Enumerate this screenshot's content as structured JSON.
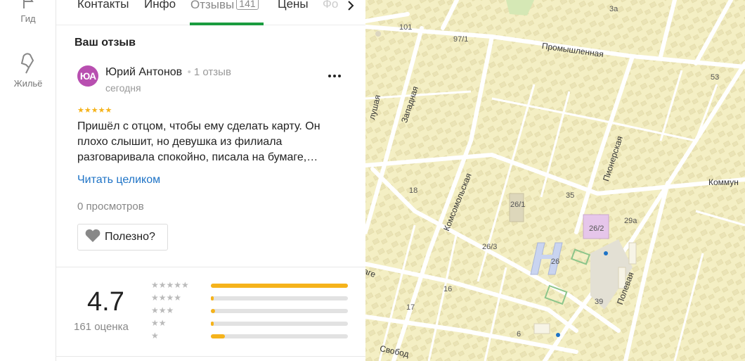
{
  "rail": {
    "guide_label": "Гид",
    "housing_label": "Жильё"
  },
  "tabs": {
    "contacts": "Контакты",
    "info": "Инфо",
    "reviews": "Отзывы",
    "reviews_count": "141",
    "prices": "Цены",
    "photos": "Фо"
  },
  "review": {
    "section_title": "Ваш отзыв",
    "avatar_initials": "ЮА",
    "avatar_color": "#b84fb0",
    "author": "Юрий Антонов",
    "author_reviews": "1 отзыв",
    "date": "сегодня",
    "rating": 5,
    "stars": "★★★★★",
    "text": "Пришёл с отцом, чтобы ему сделать карту. Он плохо слышит, но девушка из филиала разговаривала спокойно, писала на бумаге,…",
    "read_more": "Читать целиком",
    "views": "0 просмотров",
    "useful_label": "Полезно?"
  },
  "summary": {
    "rating": "4.7",
    "count_label": "161 оценка",
    "distribution": [
      {
        "stars": "★★★★★",
        "fraction": 1.0
      },
      {
        "stars": "★★★★",
        "fraction": 0.02
      },
      {
        "stars": "★★★",
        "fraction": 0.03
      },
      {
        "stars": "★★",
        "fraction": 0.02
      },
      {
        "stars": "★",
        "fraction": 0.1
      }
    ]
  },
  "map": {
    "streets": {
      "promyshlennaya": "Промышленная",
      "zapadnaya": "Западная",
      "pionerskaya": "Пионерская",
      "komsomolskaya": "Комсомольская",
      "polevaya": "Полевая",
      "kommun": "Коммун",
      "svobod": "Свобод",
      "lushaya": "лушая",
      "age": "аге"
    },
    "labels": [
      "101",
      "97/1",
      "3а",
      "53",
      "18",
      "35",
      "26/1",
      "26/2",
      "29а",
      "26/3",
      "26",
      "16",
      "39",
      "17",
      "6"
    ],
    "colors": {
      "background": "#f4efc4",
      "road": "#ffffff",
      "building": "#e7e0b2",
      "accent_green": "#1a9c3f",
      "star_yellow": "#f5b31b",
      "link_blue": "#1e73c6"
    }
  }
}
